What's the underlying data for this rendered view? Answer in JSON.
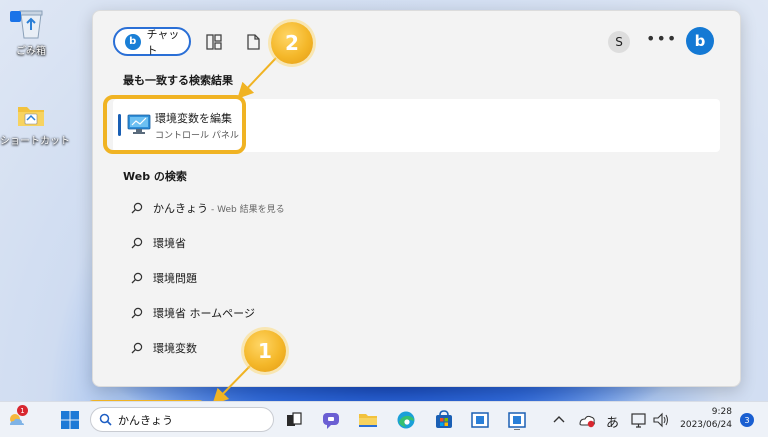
{
  "desktop": {
    "icons": [
      {
        "label": "ごみ箱"
      },
      {
        "label": "ショートカット"
      }
    ]
  },
  "search_panel": {
    "tabs": {
      "chat_label": "チャット"
    },
    "avatar_initial": "S",
    "more_label": "•••",
    "bing_letter": "b",
    "best_match": {
      "heading": "最も一致する検索結果",
      "name": "環境変数を編集",
      "subtitle": "コントロール パネル"
    },
    "web_search": {
      "heading": "Web の検索",
      "items": [
        {
          "text": "かんきょう",
          "hint": "- Web 結果を見る"
        },
        {
          "text": "環境省"
        },
        {
          "text": "環境問題"
        },
        {
          "text": "環境省 ホームページ"
        },
        {
          "text": "環境変数"
        }
      ]
    }
  },
  "callouts": {
    "step1": "1",
    "step2": "2"
  },
  "taskbar": {
    "weather_badge": "1",
    "search_value": "かんきょう",
    "ime_label": "あ",
    "time": "9:28",
    "date": "2023/06/24",
    "notification_count": "3"
  },
  "colors": {
    "accent": "#2a6fd6",
    "highlight": "#f0b323",
    "notification": "#1a5fd1"
  }
}
